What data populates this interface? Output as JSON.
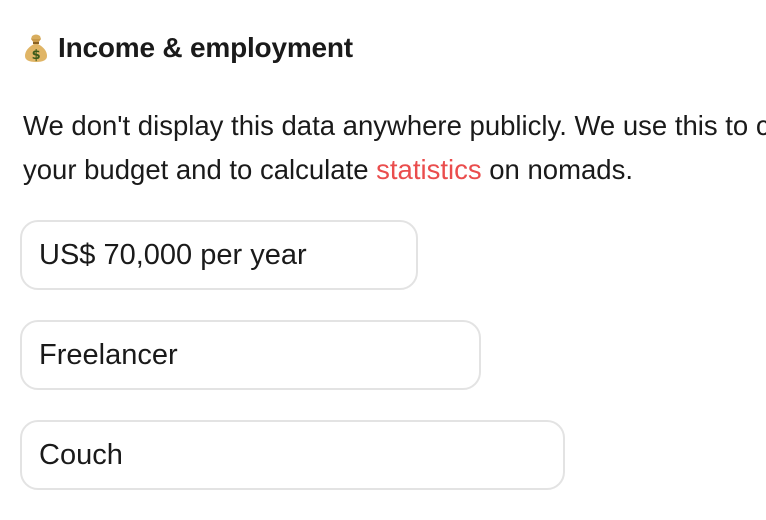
{
  "section": {
    "icon": "money-bag-icon",
    "title": "Income & employment"
  },
  "description": {
    "line1": "We don't display this data anywhere publicly. We use this to calculate",
    "line2_before": "your budget and to calculate ",
    "link_text": "statistics",
    "line2_after": " on nomads."
  },
  "fields": {
    "income": "US$ 70,000 per year",
    "employment": "Freelancer",
    "housing": "Couch"
  },
  "colors": {
    "link": "#ea4d4d",
    "field_border": "#e3e3e3",
    "text": "#1a1a1a"
  }
}
